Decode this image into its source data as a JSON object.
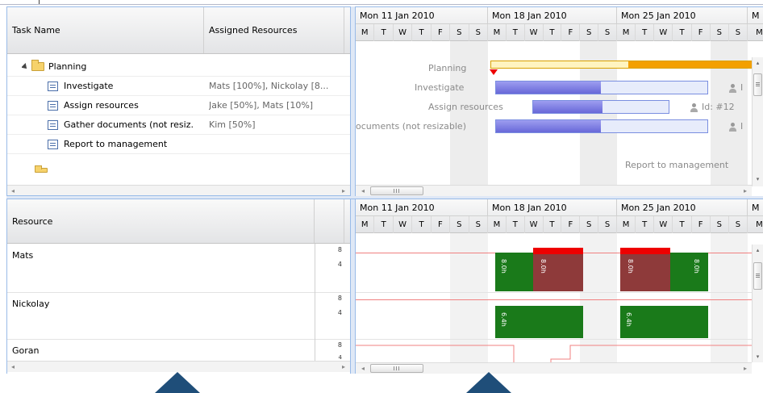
{
  "schedule": {
    "headers": {
      "task_name": "Task Name",
      "assigned_resources": "Assigned Resources"
    },
    "tasks": [
      {
        "name": "Planning",
        "resources": "",
        "is_parent": true
      },
      {
        "name": "Investigate",
        "resources": "Mats [100%], Nickolay [8..."
      },
      {
        "name": "Assign resources",
        "resources": "Jake [50%], Mats [10%]"
      },
      {
        "name": "Gather documents (not resiz.",
        "resources": "Kim [50%]"
      },
      {
        "name": "Report to management",
        "resources": ""
      }
    ],
    "weeks": [
      "Mon 11 Jan 2010",
      "Mon 18 Jan 2010",
      "Mon 25 Jan 2010",
      "M"
    ],
    "day_letters": [
      "M",
      "T",
      "W",
      "T",
      "F",
      "S",
      "S",
      "M",
      "T",
      "W",
      "T",
      "F",
      "S",
      "S",
      "M",
      "T",
      "W",
      "T",
      "F",
      "S",
      "S",
      "M"
    ],
    "timeline_labels": {
      "planning": "Planning",
      "investigate": "Investigate",
      "assign": "Assign resources",
      "gather": "ocuments (not resizable)",
      "report": "Report to management",
      "assign_id": "Id: #12",
      "trunc_i": "I"
    },
    "progress": {
      "investigate": 0.5,
      "assign": 0.5,
      "gather": 0.5
    }
  },
  "resources": {
    "header": "Resource",
    "items": [
      {
        "name": "Mats"
      },
      {
        "name": "Nickolay"
      },
      {
        "name": "Goran"
      }
    ],
    "scale": {
      "top": "8",
      "mid": "4"
    },
    "hist_labels": {
      "mats_1": "8.0h",
      "mats_2": "8.0h",
      "mats_3": "8.0h",
      "mats_4": "8.0h",
      "nick_1": "6.4h",
      "nick_2": "6.4h"
    }
  },
  "scroll": {
    "grip": "III",
    "left": "◂",
    "right": "▸",
    "up": "▴",
    "down": "▾"
  },
  "colors": {
    "bar_fill": "#6868d8",
    "planning_fill": "#f3a000",
    "hist_green": "#1a7a1a",
    "hist_over": "#8e3a3a",
    "hist_top": "#e00000",
    "arrow": "#1f4e79"
  }
}
